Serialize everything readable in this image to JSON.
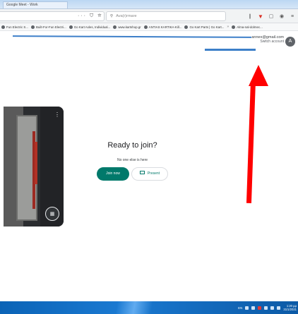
{
  "browser": {
    "tab_title": "Google Meet - Work",
    "toolbar_actions": "··· ⛉ ☆",
    "search_placeholder": "Ava(r)rmare",
    "bookmarks": [
      "Fun Electric S...",
      "Built-For-Fun Electri...",
      "Go Kart Axles, Individual...",
      "www.kartshop.gr",
      "ANTIAS KARTIKA-Kill...",
      "Go Kart Parts | Go Kart...",
      "Alma-nal-dolmec..."
    ],
    "bookmarks_more": "»"
  },
  "account": {
    "email": "annex@gmail.com",
    "switch_label": "Switch account",
    "avatar_letter": "A"
  },
  "meeting": {
    "title": "Ready to join?",
    "status": "No one else is here",
    "join_label": "Join now",
    "present_label": "Present"
  },
  "taskbar": {
    "language": "EN",
    "time": "1:20 μμ",
    "date": "31/1/2021"
  },
  "colors": {
    "join_button": "#00796b",
    "annotation_arrow": "#ff0000",
    "annotation_line": "#3d7fc9",
    "taskbar": "#1a79d1"
  }
}
